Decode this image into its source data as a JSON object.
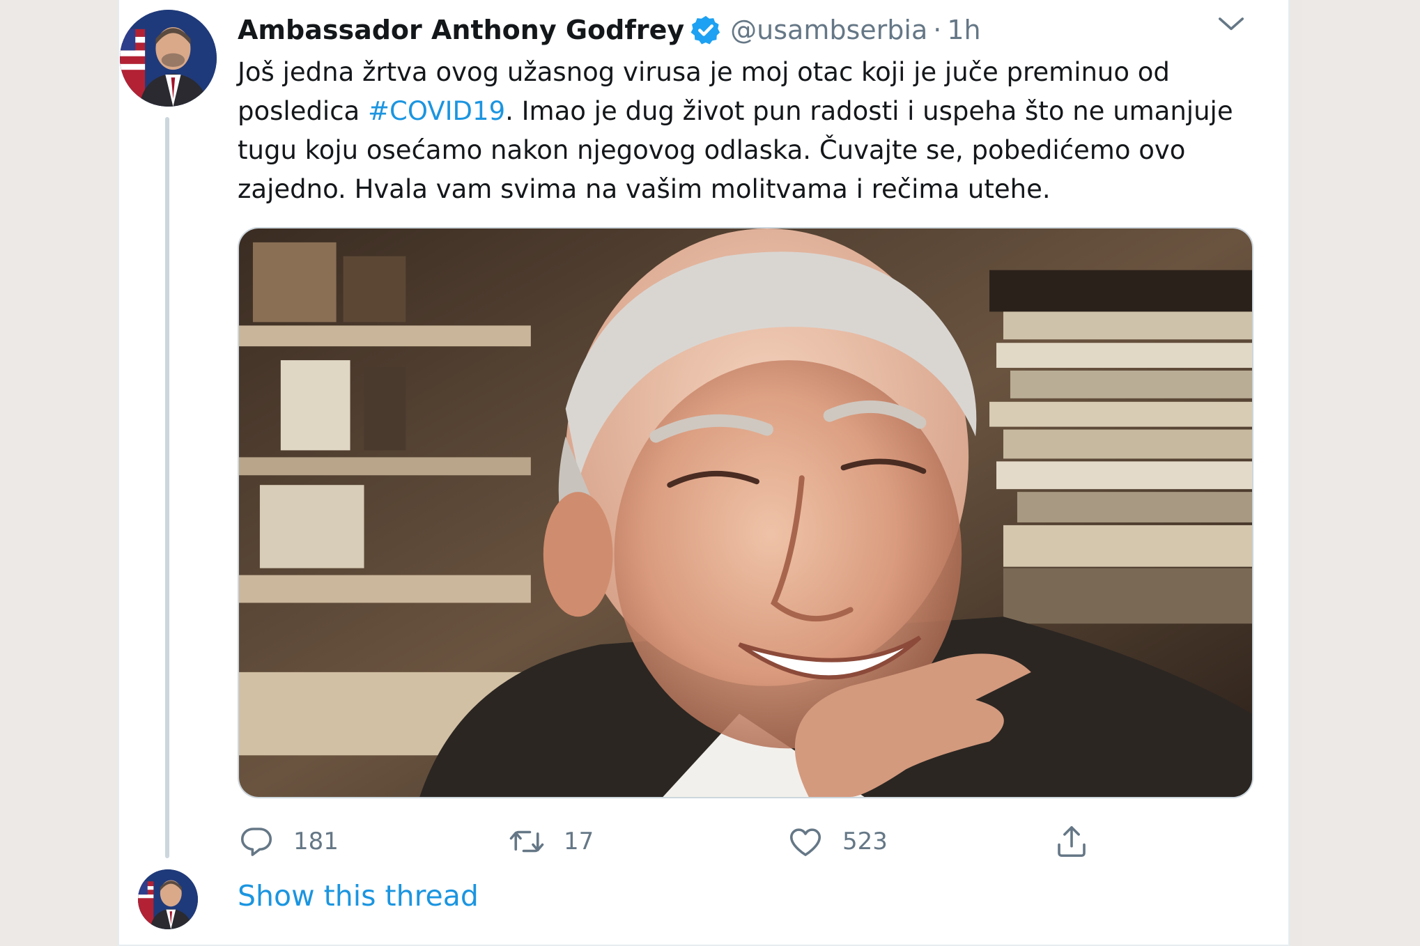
{
  "tweet": {
    "display_name": "Ambassador Anthony Godfrey",
    "handle": "@usambserbia",
    "separator": "·",
    "time": "1h",
    "text_before_hashtag": "Još jedna žrtva ovog užasnog virusa je moj otac koji je juče preminuo od posledica ",
    "hashtag": "#COVID19",
    "text_after_hashtag": ". Imao je dug život pun radosti i uspeha što ne umanjuje tugu koju osećamo nakon njegovog odlaska. Čuvajte se, pobedićemo ovo zajedno. Hvala vam svima na vašim molitvama i rečima utehe.",
    "media_image": "elderly-man-smiling-photo"
  },
  "actions": {
    "reply_count": "181",
    "retweet_count": "17",
    "like_count": "523",
    "reply_icon": "speech-bubble-icon",
    "retweet_icon": "retweet-arrows-icon",
    "like_icon": "heart-icon",
    "share_icon": "share-upload-icon"
  },
  "thread": {
    "show_thread_label": "Show this thread"
  },
  "colors": {
    "link": "#1b95e0",
    "verified": "#1da1f2",
    "muted": "#657786",
    "text": "#14171a"
  }
}
